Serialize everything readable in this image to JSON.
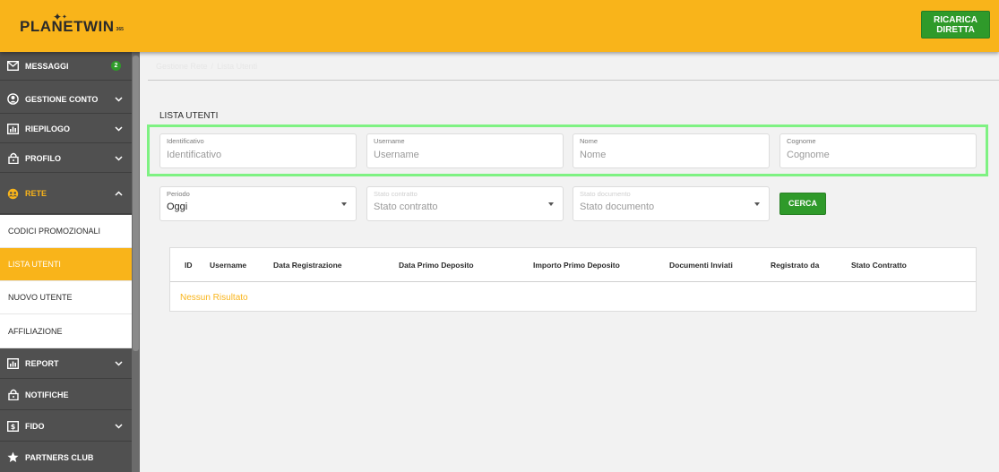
{
  "header": {
    "logo_text": "PLANETWIN",
    "logo_sup": "365",
    "recharge_label_line1": "RICARICA",
    "recharge_label_line2": "DIRETTA"
  },
  "sidebar": {
    "items": [
      {
        "label": "MESSAGGI",
        "icon": "envelope-icon",
        "badge": "2"
      },
      {
        "label": "GESTIONE CONTO",
        "icon": "user-circle-icon"
      },
      {
        "label": "RIEPILOGO",
        "icon": "chart-icon"
      },
      {
        "label": "PROFILO",
        "icon": "lock-icon"
      },
      {
        "label": "RETE",
        "icon": "network-icon"
      },
      {
        "label": "REPORT",
        "icon": "chart-icon"
      },
      {
        "label": "NOTIFICHE",
        "icon": "lock-icon"
      },
      {
        "label": "FIDO",
        "icon": "money-icon"
      },
      {
        "label": "PARTNERS CLUB",
        "icon": "star-icon"
      }
    ],
    "subitems": [
      {
        "label": "CODICI PROMOZIONALI"
      },
      {
        "label": "LISTA UTENTI"
      },
      {
        "label": "NUOVO UTENTE"
      },
      {
        "label": "AFFILIAZIONE"
      }
    ]
  },
  "breadcrumb": {
    "root": "Gestione Rete",
    "current": "Lista Utenti"
  },
  "page_title": "LISTA UTENTI",
  "filters": {
    "identificativo": {
      "label": "Identificativo",
      "placeholder": "Identificativo"
    },
    "username": {
      "label": "Username",
      "placeholder": "Username"
    },
    "nome": {
      "label": "Nome",
      "placeholder": "Nome"
    },
    "cognome": {
      "label": "Cognome",
      "placeholder": "Cognome"
    },
    "periodo": {
      "label": "Periodo",
      "value": "Oggi"
    },
    "stato_contratto": {
      "label": "Stato contratto",
      "value": "Stato contratto"
    },
    "stato_documento": {
      "label": "Stato documento",
      "value": "Stato documento"
    },
    "search_label": "CERCA"
  },
  "table": {
    "columns": [
      "ID",
      "Username",
      "Data Registrazione",
      "Data Primo Deposito",
      "Importo Primo Deposito",
      "Documenti Inviati",
      "Registrato da",
      "Stato Contratto"
    ],
    "empty_text": "Nessun Risultato"
  },
  "colors": {
    "brand": "#f9b41a",
    "success": "#2f9a2a",
    "sidebar": "#505050",
    "highlight": "#7ff283"
  }
}
